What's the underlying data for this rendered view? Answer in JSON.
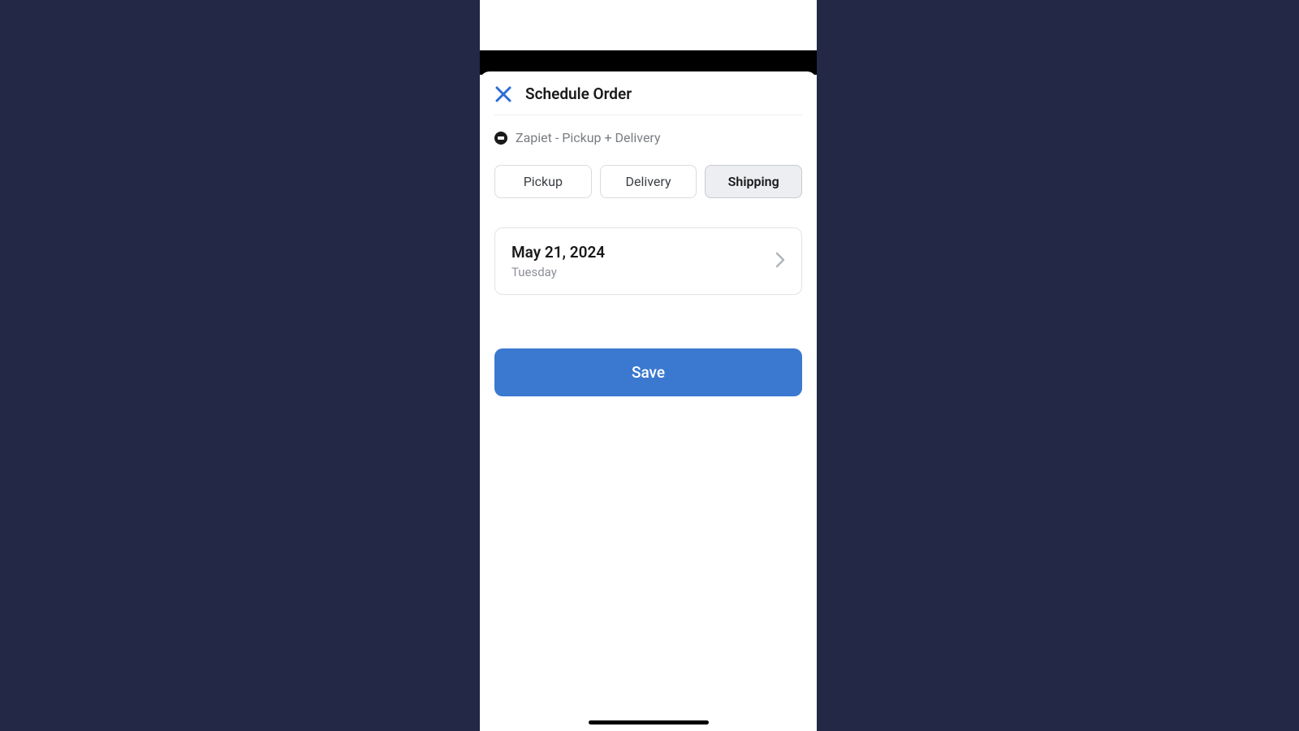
{
  "header": {
    "title": "Schedule Order"
  },
  "app": {
    "name": "Zapiet - Pickup + Delivery"
  },
  "tabs": {
    "items": [
      "Pickup",
      "Delivery",
      "Shipping"
    ],
    "selected_index": 2
  },
  "date": {
    "value": "May 21, 2024",
    "weekday": "Tuesday"
  },
  "actions": {
    "save_label": "Save"
  }
}
